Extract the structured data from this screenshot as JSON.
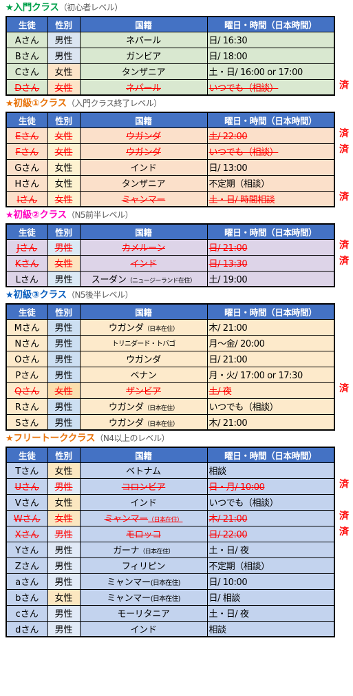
{
  "columns": [
    "生徒",
    "性別",
    "国籍",
    "曜日・時間（日本時間）"
  ],
  "done_label": "済",
  "sections": [
    {
      "id": "intro",
      "star": "★",
      "title": "入門クラス",
      "level": "（初心者レベル）",
      "color": "#00a14b",
      "rows": [
        {
          "student": "Aさん",
          "gender": "男性",
          "nation": "ネパール",
          "time": "日/ 16:30",
          "cancelled": false,
          "done": false
        },
        {
          "student": "Bさん",
          "gender": "男性",
          "nation": "ガンビア",
          "time": "日/ 18:00",
          "cancelled": false,
          "done": false
        },
        {
          "student": "Cさん",
          "gender": "女性",
          "nation": "タンザニア",
          "time": "土・日/ 16:00 or 17:00",
          "cancelled": false,
          "done": false
        },
        {
          "student": "Dさん",
          "gender": "女性",
          "nation": "ネパール",
          "time": "いつでも（相談）",
          "cancelled": true,
          "done": true
        }
      ]
    },
    {
      "id": "beginner1",
      "star": "★",
      "title": "初級①クラス",
      "level": "（入門クラス終了レベル）",
      "color": "#e8740c",
      "rows": [
        {
          "student": "Eさん",
          "gender": "女性",
          "nation": "ウガンダ",
          "time": "土/ 22:00",
          "cancelled": true,
          "done": true
        },
        {
          "student": "Fさん",
          "gender": "女性",
          "nation": "ウガンダ",
          "time": "いつでも（相談）",
          "cancelled": true,
          "done": true
        },
        {
          "student": "Gさん",
          "gender": "女性",
          "nation": "インド",
          "time": "日/ 13:00",
          "cancelled": false,
          "done": false
        },
        {
          "student": "Hさん",
          "gender": "女性",
          "nation": "タンザニア",
          "time": "不定期（相談）",
          "cancelled": false,
          "done": false
        },
        {
          "student": "Iさん",
          "gender": "女性",
          "nation": "ミャンマー",
          "time": "土・日/ 時間相談",
          "cancelled": true,
          "done": true
        }
      ]
    },
    {
      "id": "beginner2",
      "star": "★",
      "title": "初級②クラス",
      "level": "（N5前半レベル）",
      "color": "#ff00c0",
      "rows": [
        {
          "student": "Jさん",
          "gender": "男性",
          "nation": "カメルーン",
          "time": "日/ 21:00",
          "cancelled": true,
          "done": true
        },
        {
          "student": "Kさん",
          "gender": "女性",
          "nation": "インド",
          "time": "日/ 13:30",
          "cancelled": true,
          "done": true
        },
        {
          "student": "Lさん",
          "gender": "男性",
          "nation": "スーダン",
          "nation_note": "（ニュージーランド在住）",
          "time": "土/ 19:00",
          "cancelled": false,
          "done": false
        }
      ]
    },
    {
      "id": "beginner3",
      "star": "★",
      "title": "初級③クラス",
      "level": "（N5後半レベル）",
      "color": "#0b5fbf",
      "rows": [
        {
          "student": "Mさん",
          "gender": "男性",
          "nation": "ウガンダ",
          "nation_note": "（日本在住）",
          "time": "木/ 21:00",
          "cancelled": false,
          "done": false
        },
        {
          "student": "Nさん",
          "gender": "男性",
          "nation": "トリニダード・トバゴ",
          "nation_small": true,
          "time": "月～金/ 20:00",
          "cancelled": false,
          "done": false
        },
        {
          "student": "Oさん",
          "gender": "男性",
          "nation": "ウガンダ",
          "time": "日/ 21:00",
          "cancelled": false,
          "done": false
        },
        {
          "student": "Pさん",
          "gender": "男性",
          "nation": "ベナン",
          "time": "月・火/ 17:00 or 17:30",
          "cancelled": false,
          "done": false
        },
        {
          "student": "Qさん",
          "gender": "女性",
          "nation": "ザンビア",
          "time": "土/ 夜",
          "cancelled": true,
          "done": true
        },
        {
          "student": "Rさん",
          "gender": "男性",
          "nation": "ウガンダ",
          "nation_note": "（日本在住）",
          "time": "いつでも（相談）",
          "cancelled": false,
          "done": false
        },
        {
          "student": "Sさん",
          "gender": "男性",
          "nation": "ウガンダ",
          "nation_note": "（日本在住）",
          "time": "木/ 21:00",
          "cancelled": false,
          "done": false
        }
      ]
    },
    {
      "id": "freetalk",
      "star": "★",
      "title": "フリートーククラス",
      "level": "（N4以上のレベル）",
      "color": "#e8740c",
      "rows": [
        {
          "student": "Tさん",
          "gender": "女性",
          "nation": "ベトナム",
          "time": "相談",
          "cancelled": false,
          "done": false
        },
        {
          "student": "Uさん",
          "gender": "男性",
          "nation": "コロンビア",
          "time": "日・月/ 10:00",
          "cancelled": true,
          "done": true
        },
        {
          "student": "Vさん",
          "gender": "女性",
          "nation": "インド",
          "time": "いつでも（相談）",
          "cancelled": false,
          "done": false
        },
        {
          "student": "Wさん",
          "gender": "女性",
          "nation": "ミャンマー",
          "nation_note": "（日本在住）",
          "time": "木/ 21:00",
          "cancelled": true,
          "done": true
        },
        {
          "student": "Xさん",
          "gender": "男性",
          "nation": "モロッコ",
          "time": "日/ 22:00",
          "cancelled": true,
          "done": true
        },
        {
          "student": "Yさん",
          "gender": "男性",
          "nation": "ガーナ",
          "nation_note": "（日本在住）",
          "time": "土・日/ 夜",
          "cancelled": false,
          "done": false
        },
        {
          "student": "Zさん",
          "gender": "男性",
          "nation": "フィリピン",
          "time": "不定期（相談）",
          "cancelled": false,
          "done": false
        },
        {
          "student": "aさん",
          "gender": "男性",
          "nation": "ミャンマー",
          "nation_note_tight": "(日本在住)",
          "time": "日/ 10:00",
          "cancelled": false,
          "done": false
        },
        {
          "student": "bさん",
          "gender": "女性",
          "nation": "ミャンマー",
          "nation_note_tight": "(日本在住)",
          "time": "日/ 相談",
          "cancelled": false,
          "done": false
        },
        {
          "student": "cさん",
          "gender": "男性",
          "nation": "モーリタニア",
          "time": "土・日/ 夜",
          "cancelled": false,
          "done": false
        },
        {
          "student": "dさん",
          "gender": "男性",
          "nation": "インド",
          "time": "相談",
          "cancelled": false,
          "done": false
        }
      ]
    }
  ]
}
